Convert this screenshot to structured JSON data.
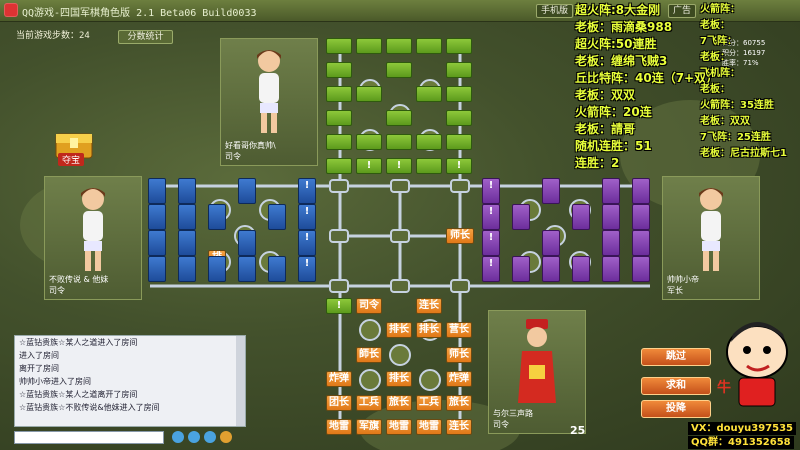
{
  "window": {
    "title": "QQ游戏-四国军棋角色版 2.1 Beta06 Build0033",
    "buttons": [
      "手机版",
      "广告"
    ]
  },
  "game": {
    "step_label": "当前游戏步数：24",
    "stats_button": "分数统计",
    "treasure_label": "夺宝"
  },
  "players": {
    "top": {
      "name": "好看哥你真帅\\",
      "rank": "司令"
    },
    "left": {
      "name": "不败传说 & 他妹",
      "rank": "司令"
    },
    "right": {
      "name": "帅帅小帝",
      "rank": "军长"
    },
    "bottom": {
      "name": "与尔三声路",
      "rank": "司令",
      "level": "25"
    }
  },
  "player_info": {
    "score": "积分：60755",
    "points": "积分：16197",
    "winrate": "胜率：71%"
  },
  "pieces": {
    "bottom": [
      [
        "司令",
        "连长"
      ],
      [
        "排长",
        "排长",
        "营长"
      ],
      [
        "師长",
        "师长"
      ],
      [
        "炸弹",
        "排长",
        "炸弹"
      ],
      [
        "团长",
        "工兵",
        "旅长",
        "工兵",
        "旅长"
      ],
      [
        "地雷",
        "军旗",
        "地雷",
        "地雷",
        "连长"
      ]
    ],
    "left_label": "排",
    "right_label": "师长"
  },
  "actions": {
    "skip": "跳过",
    "peace": "求和",
    "surrender": "投降"
  },
  "chat": {
    "lines": [
      "☆蓝钻贵族☆某人之道进入了房间",
      "进入了房间",
      "离开了房间",
      "帅帅小帝进入了房间",
      "☆蓝钻贵族☆某人之道离开了房间",
      "☆蓝钻贵族☆不败传说&他妹进入了房间"
    ]
  },
  "overlay": {
    "middle": [
      "超火阵:8大金刚",
      "老板：雨滴桑988",
      "超火阵:50連胜",
      "老板：缠绵飞贼3",
      "丘比特阵：40连（7+双）",
      "老板：双双",
      "火箭阵：20连",
      "老板：請哥",
      "随机连胜：51",
      "连胜：2"
    ],
    "right": [
      "火箭阵：",
      "老板：",
      "7飞阵：",
      "老板：",
      "飞机阵：",
      "老板：",
      "火箭阵：35连胜",
      "老板：双双",
      "7飞阵：25连胜",
      "老板：尼古拉斯七1"
    ],
    "contacts": [
      "VX：douyu397535",
      "QQ群：491352658"
    ]
  },
  "colors": {
    "accent": "#e8ff3a",
    "bg": "#43512c",
    "orange_piece": "#e07818"
  }
}
